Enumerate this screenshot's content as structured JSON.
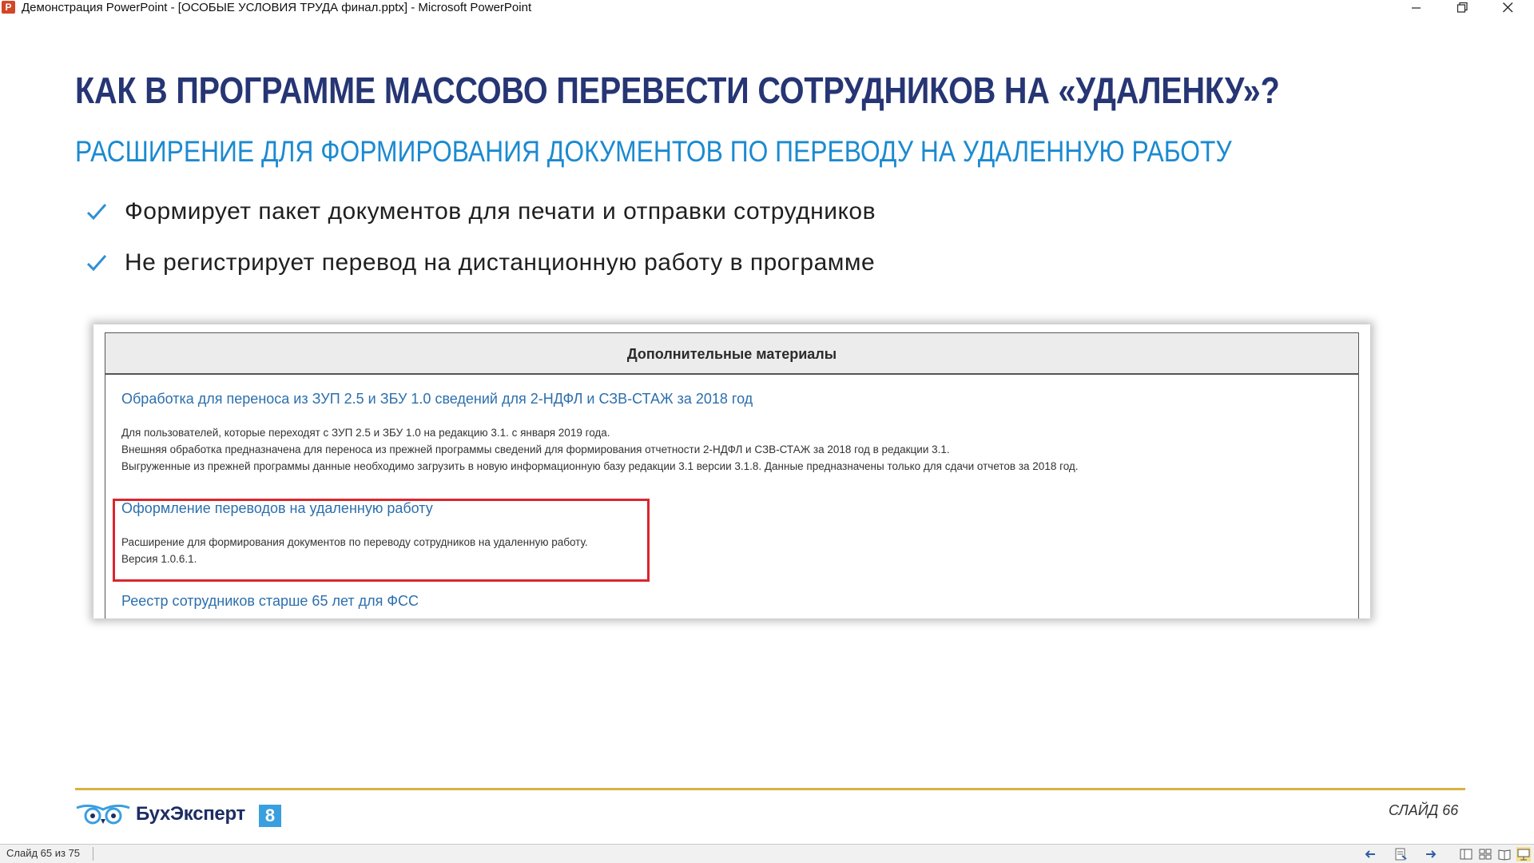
{
  "window": {
    "title": "Демонстрация PowerPoint - [ОСОБЫЕ УСЛОВИЯ ТРУДА финал.pptx] - Microsoft PowerPoint",
    "app_icon_letter": "P"
  },
  "slide": {
    "title": "КАК В ПРОГРАММЕ МАССОВО ПЕРЕВЕСТИ СОТРУДНИКОВ НА «УДАЛЕНКУ»?",
    "subtitle": "РАСШИРЕНИЕ ДЛЯ ФОРМИРОВАНИЯ ДОКУМЕНТОВ ПО ПЕРЕВОДУ НА УДАЛЕННУЮ РАБОТУ",
    "bullets": [
      "Формирует пакет документов для печати и отправки сотрудников",
      "Не регистрирует перевод на дистанционную работу в программе"
    ],
    "panel": {
      "header": "Дополнительные материалы",
      "entries": [
        {
          "link": "Обработка для переноса из ЗУП 2.5 и ЗБУ 1.0 сведений для 2-НДФЛ и СЗВ-СТАЖ за 2018 год",
          "lines": [
            "Для пользователей, которые переходят с ЗУП 2.5 и ЗБУ 1.0 на редакцию 3.1. с января 2019 года.",
            "Внешняя обработка предназначена для переноса из прежней программы сведений для формирования отчетности 2-НДФЛ и СЗВ-СТАЖ за 2018 год в редакции 3.1.",
            "Выгруженные из прежней программы данные необходимо загрузить в новую информационную базу редакции 3.1 версии 3.1.8. Данные предназначены только для сдачи отчетов за 2018 год."
          ]
        },
        {
          "link": "Оформление переводов на удаленную работу",
          "lines": [
            "Расширение для формирования документов по переводу сотрудников на удаленную работу.",
            "Версия 1.0.6.1."
          ]
        },
        {
          "link": "Реестр сотрудников старше 65 лет для ФСС",
          "lines": []
        }
      ]
    },
    "footer": {
      "logo_text": "БухЭксперт",
      "logo_badge": "8",
      "slide_label": "СЛАЙД 66"
    }
  },
  "statusbar": {
    "text": "Слайд 65 из 75"
  },
  "colors": {
    "title": "#263574",
    "subtitle": "#1b8ad1",
    "check": "#2f8fd6",
    "link": "#2c6fad",
    "highlight_border": "#d9262e",
    "footer_line": "#d8b241"
  }
}
